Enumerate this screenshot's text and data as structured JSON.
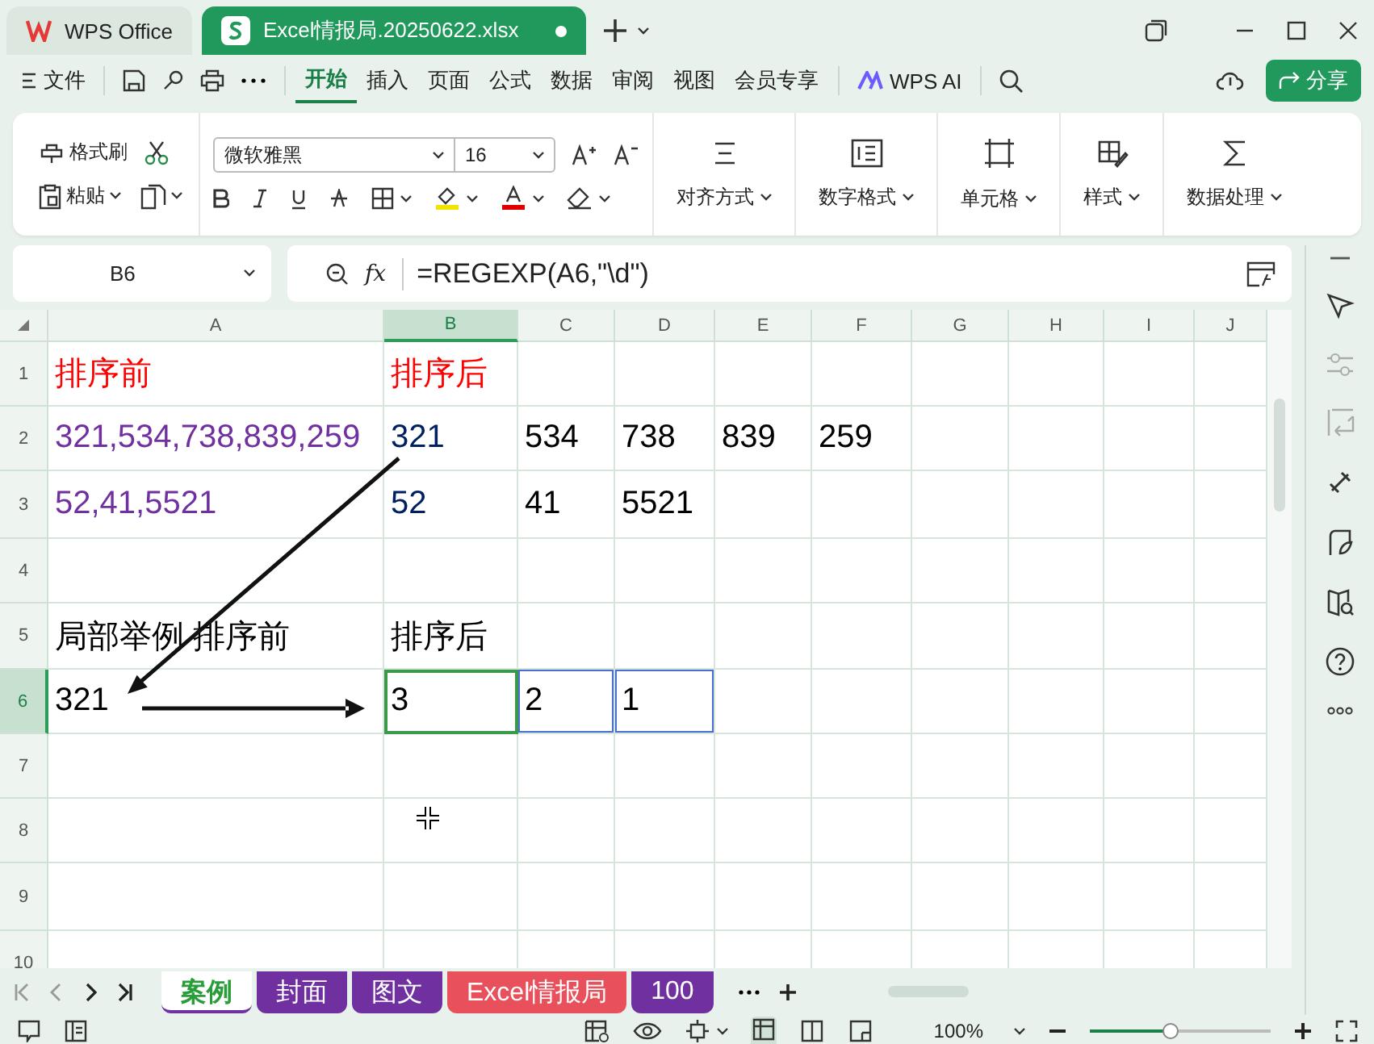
{
  "title_bar": {
    "tabs": [
      {
        "label": "WPS Office",
        "kind": "home",
        "selected": false
      },
      {
        "label": "Excel情报局.20250622.xlsx",
        "kind": "file",
        "selected": true
      }
    ]
  },
  "menu_bar": {
    "file_label": "文件",
    "items": [
      {
        "label": "开始",
        "selected": true
      },
      {
        "label": "插入",
        "selected": false
      },
      {
        "label": "页面",
        "selected": false
      },
      {
        "label": "公式",
        "selected": false
      },
      {
        "label": "数据",
        "selected": false
      },
      {
        "label": "审阅",
        "selected": false
      },
      {
        "label": "视图",
        "selected": false
      },
      {
        "label": "会员专享",
        "selected": false
      }
    ],
    "ai_label": "WPS AI",
    "share_label": "分享"
  },
  "ribbon": {
    "format_painter": "格式刷",
    "paste": "粘贴",
    "font": "微软雅黑",
    "font_size": "16",
    "groups": [
      {
        "label": "对齐方式",
        "kind": "align"
      },
      {
        "label": "数字格式",
        "kind": "number"
      },
      {
        "label": "单元格",
        "kind": "cell"
      },
      {
        "label": "样式",
        "kind": "style"
      },
      {
        "label": "数据处理",
        "kind": "data"
      }
    ]
  },
  "formula_bar": {
    "name_box": "B6",
    "fx": "fx",
    "formula": "=REGEXP(A6,\"\\d\")"
  },
  "sheet": {
    "columns": [
      {
        "label": "A",
        "selected": false
      },
      {
        "label": "B",
        "selected": true
      },
      {
        "label": "C",
        "selected": false
      },
      {
        "label": "D",
        "selected": false
      },
      {
        "label": "E",
        "selected": false
      },
      {
        "label": "F",
        "selected": false
      },
      {
        "label": "G",
        "selected": false
      },
      {
        "label": "H",
        "selected": false
      },
      {
        "label": "I",
        "selected": false
      },
      {
        "label": "J",
        "selected": false
      }
    ],
    "rows": [
      {
        "label": "1",
        "selected": false,
        "cells": [
          {
            "text": "排序前",
            "color": "#ff0000"
          },
          {
            "text": "排序后",
            "color": "#ff0000"
          }
        ]
      },
      {
        "label": "2",
        "selected": false,
        "cells": [
          {
            "text": "321,534,738,839,259",
            "color": "#7030a0"
          },
          {
            "text": "321",
            "color": "#002060"
          },
          {
            "text": "534"
          },
          {
            "text": "738"
          },
          {
            "text": "839"
          },
          {
            "text": "259"
          }
        ]
      },
      {
        "label": "3",
        "selected": false,
        "cells": [
          {
            "text": "52,41,5521",
            "color": "#7030a0"
          },
          {
            "text": "52",
            "color": "#002060"
          },
          {
            "text": "41"
          },
          {
            "text": "5521"
          }
        ]
      },
      {
        "label": "4",
        "selected": false
      },
      {
        "label": "5",
        "selected": false,
        "cells": [
          {
            "text": "局部举例 排序前"
          },
          {
            "text": "排序后"
          }
        ]
      },
      {
        "label": "6",
        "selected": true,
        "cells": [
          {
            "text": "321",
            "in_range": false
          },
          {
            "text": "3"
          },
          {
            "text": "2",
            "in_range": true
          },
          {
            "text": "1",
            "in_range": true
          }
        ]
      },
      {
        "label": "7",
        "selected": false
      },
      {
        "label": "8",
        "selected": false
      },
      {
        "label": "9",
        "selected": false
      },
      {
        "label": "10",
        "selected": false
      }
    ]
  },
  "sheet_tabs": [
    {
      "label": "案例",
      "selected": true,
      "color": "#ffffff"
    },
    {
      "label": "封面",
      "selected": false,
      "color": "#7030a0"
    },
    {
      "label": "图文",
      "selected": false,
      "color": "#7030a0"
    },
    {
      "label": "Excel情报局",
      "selected": false,
      "color": "#e8505b"
    },
    {
      "label": "100",
      "selected": false,
      "color": "#7030a0"
    }
  ],
  "status_bar": {
    "zoom": "100%",
    "level": 0.45
  }
}
